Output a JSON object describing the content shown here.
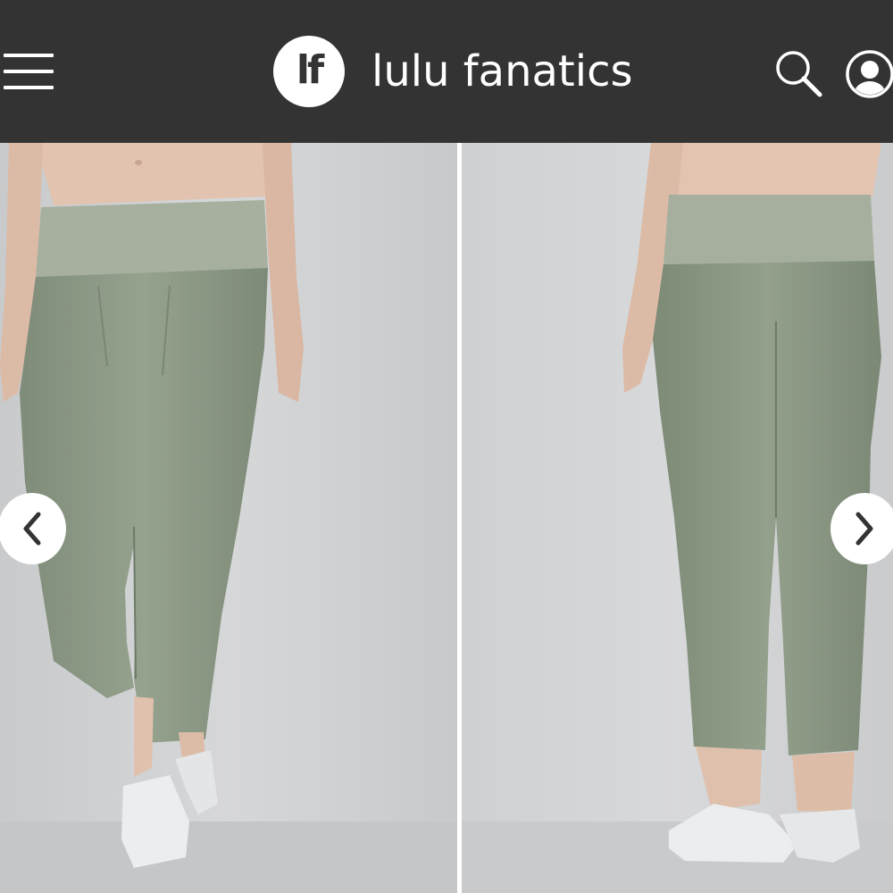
{
  "header": {
    "logo_text": "lf",
    "brand_name": "lulu fanatics",
    "background_color": "#333333"
  },
  "icons": {
    "menu": "hamburger-menu-icon",
    "search": "search-icon",
    "profile": "user-avatar-icon",
    "prev": "chevron-left-icon",
    "next": "chevron-right-icon"
  },
  "gallery": {
    "images": [
      {
        "subject": "sage green joggers, front view"
      },
      {
        "subject": "sage green joggers, back view"
      }
    ],
    "product_color": "#8c9a86"
  }
}
